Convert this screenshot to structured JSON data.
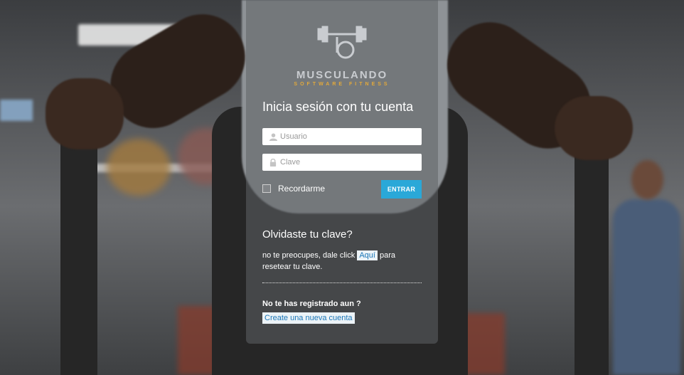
{
  "brand": {
    "name": "MUSCULANDO",
    "tagline": "SOFTWARE FITNESS",
    "icon": "dumbbell-logo-icon"
  },
  "login": {
    "title": "Inicia sesión con tu cuenta",
    "username_placeholder": "Usuario",
    "password_placeholder": "Clave",
    "remember_label": "Recordarme",
    "submit_label": "ENTRAR",
    "accent_color": "#2aa8d8"
  },
  "forgot": {
    "title": "Olvidaste tu clave?",
    "text_before": "no te preocupes, dale click ",
    "link_label": "Aquí",
    "text_after": " para resetear tu clave."
  },
  "register": {
    "title": "No te has registrado aun ?",
    "link_label": "Create una nueva cuenta"
  }
}
